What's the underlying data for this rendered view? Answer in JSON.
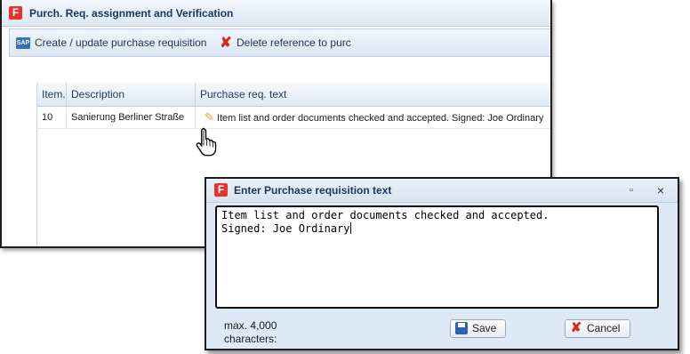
{
  "main_window": {
    "title": "Purch. Req. assignment and Verification",
    "logo_letter": "F",
    "toolbar": {
      "create_label": "Create / update purchase requisition",
      "sap_icon_text": "SAP",
      "delete_label": "Delete reference to purc"
    },
    "grid": {
      "columns": [
        "Item.",
        "Description",
        "Purchase req. text"
      ],
      "rows": [
        {
          "item": "10",
          "description": "Sanierung Berliner Straße",
          "text": "Item list and order documents checked and accepted. Signed: Joe Ordinary"
        }
      ]
    }
  },
  "dialog": {
    "title": "Enter Purchase requisition text",
    "logo_letter": "F",
    "maximize_glyph": "▫",
    "close_glyph": "×",
    "text_line1": "Item list and order documents checked and accepted.",
    "text_line2": "Signed: Joe Ordinary",
    "max_label_line1": "max. 4,000",
    "max_label_line2": "characters:",
    "save_label": "Save",
    "cancel_label": "Cancel"
  },
  "colors": {
    "accent": "#15375c",
    "logo": "#e8332a",
    "delete": "#d7261e",
    "dialog_body": "#ddeaf6"
  },
  "icons": [
    "sap-icon",
    "delete-icon",
    "pencil-icon",
    "hand-cursor-icon",
    "save-icon",
    "cancel-icon",
    "maximize-icon",
    "close-icon"
  ]
}
